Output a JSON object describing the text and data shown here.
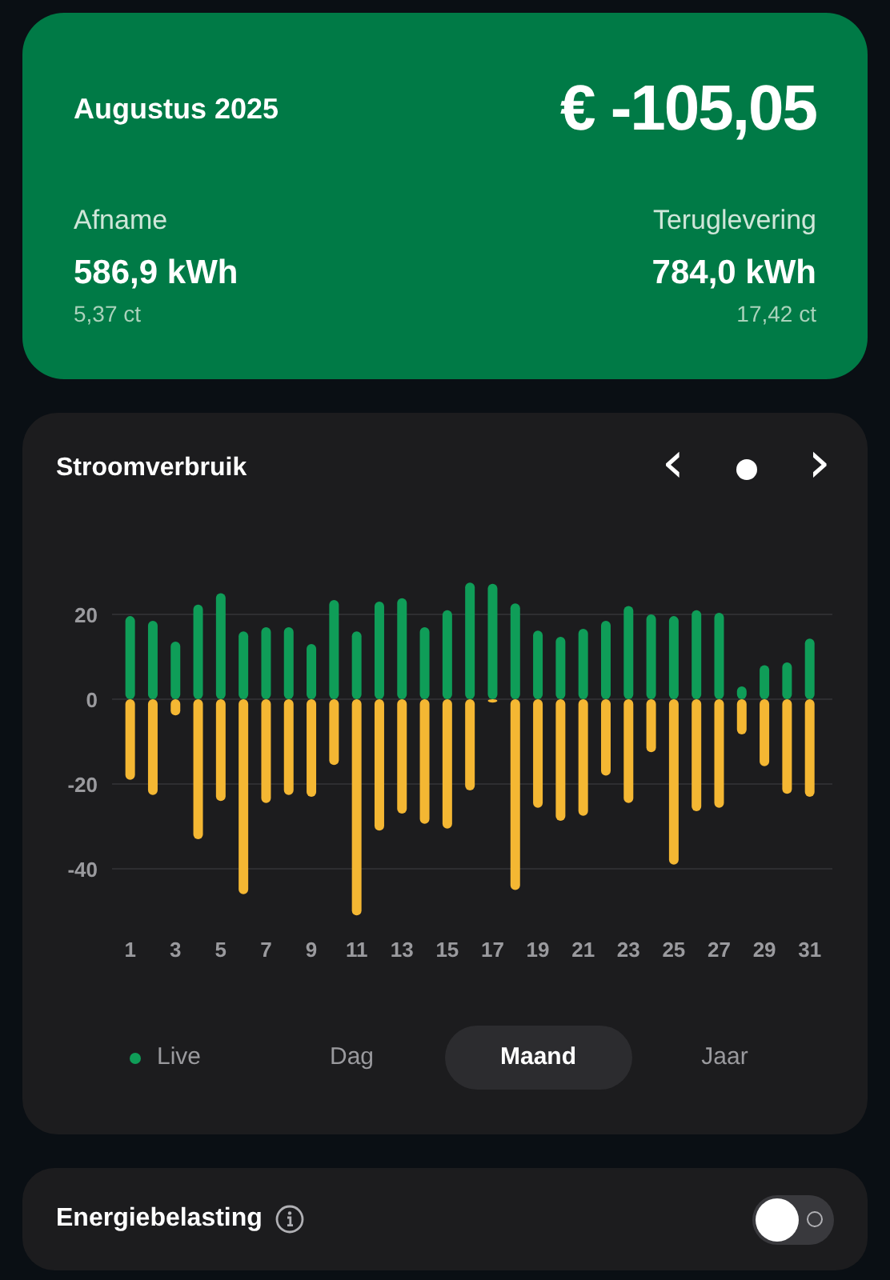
{
  "summary": {
    "period": "Augustus 2025",
    "amount": "€ -105,05",
    "stats": [
      {
        "label": "Afname",
        "value": "586,9 kWh",
        "price": "5,37 ct"
      },
      {
        "label": "Teruglevering",
        "value": "784,0 kWh",
        "price": "17,42 ct"
      }
    ]
  },
  "usage": {
    "title": "Stroomverbruik",
    "nav": {
      "previous": "‹",
      "next": "›"
    },
    "chart_data": {
      "type": "bar",
      "stacked": true,
      "grid": true,
      "x": [
        1,
        2,
        3,
        4,
        5,
        6,
        7,
        8,
        9,
        10,
        11,
        12,
        13,
        14,
        15,
        16,
        17,
        18,
        19,
        20,
        21,
        22,
        23,
        24,
        25,
        26,
        27,
        28,
        29,
        30,
        31
      ],
      "series": [
        {
          "color": "#0f9d58",
          "values": [
            19.6,
            18.5,
            13.6,
            22.3,
            25,
            16,
            17,
            17,
            13,
            23.4,
            16,
            23,
            23.8,
            17,
            21,
            27.5,
            27.2,
            22.6,
            16.2,
            14.7,
            16.6,
            18.5,
            22,
            20,
            19.6,
            21,
            20.4,
            3,
            8,
            8.7,
            14.3
          ]
        },
        {
          "color": "#f4b733",
          "values": [
            -19,
            -22.6,
            -3.8,
            -33,
            -24,
            -46,
            -24.5,
            -22.6,
            -23,
            -15.5,
            -51,
            -31,
            -27,
            -29.4,
            -30.5,
            -21.5,
            -0.8,
            -45,
            -25.6,
            -28.7,
            -27.5,
            -18,
            -24.5,
            -12.5,
            -39,
            -26.4,
            -25.6,
            -8.3,
            -15.8,
            -22.3,
            -23
          ]
        }
      ],
      "xlim": [
        0.2,
        32
      ],
      "ylim": [
        -52,
        28
      ],
      "yticks": [
        -40,
        -20,
        0,
        20
      ],
      "xticks": [
        1,
        3,
        5,
        7,
        9,
        11,
        13,
        15,
        17,
        19,
        21,
        23,
        25,
        27,
        29,
        31
      ]
    },
    "periods": [
      {
        "label": "Live",
        "live": true,
        "selected": false
      },
      {
        "label": "Dag",
        "live": false,
        "selected": false
      },
      {
        "label": "Maand",
        "live": false,
        "selected": true
      },
      {
        "label": "Jaar",
        "live": false,
        "selected": false
      }
    ]
  },
  "settings": [
    {
      "label": "Energiebelasting",
      "on": false
    }
  ]
}
